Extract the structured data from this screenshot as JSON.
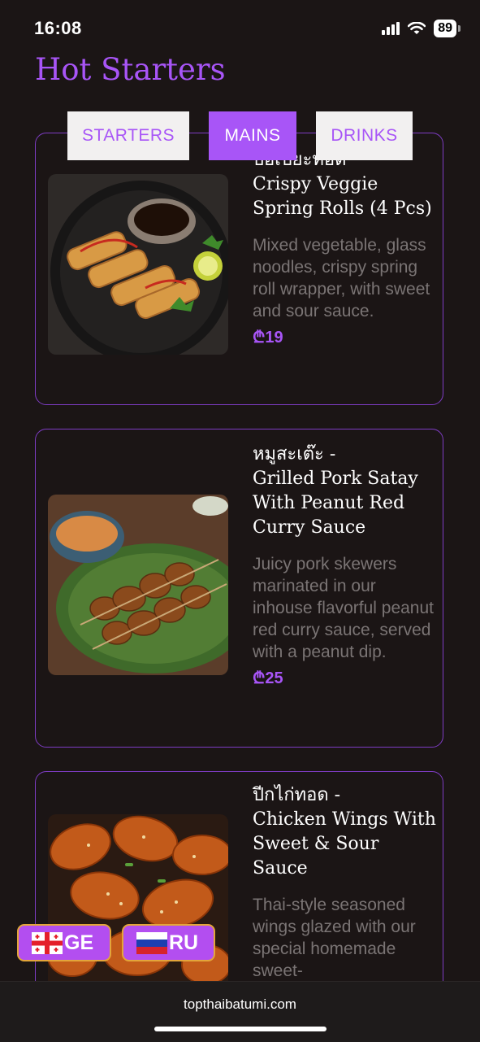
{
  "status_bar": {
    "time": "16:08",
    "battery": "89"
  },
  "page": {
    "title": "Hot Starters"
  },
  "tabs": [
    {
      "label": "STARTERS"
    },
    {
      "label": "MAINS"
    },
    {
      "label": "DRINKS"
    }
  ],
  "dishes": [
    {
      "title_thai": "ปอเปี๊ยะทอด",
      "title": "Crispy Veggie Spring Rolls (4 Pcs)",
      "description": "Mixed vegetable, glass noodles, crispy spring roll wrapper, with sweet and sour sauce.",
      "price": "₾19"
    },
    {
      "title_thai": "หมูสะเต๊ะ -",
      "title": "Grilled Pork Satay With Peanut Red Curry Sauce",
      "description": "Juicy pork skewers marinated in our inhouse flavorful peanut red curry sauce, served with a peanut dip.",
      "price": "₾25"
    },
    {
      "title_thai": "ปีกไก่ทอด -",
      "title": "Chicken Wings With Sweet & Sour Sauce",
      "description": "Thai-style seasoned wings glazed with our special homemade sweet-",
      "price": ""
    }
  ],
  "language_buttons": [
    {
      "label": "GE",
      "flag": "georgia-flag-icon"
    },
    {
      "label": "RU",
      "flag": "russia-flag-icon"
    }
  ],
  "browser": {
    "url": "topthaibatumi.com"
  },
  "colors": {
    "accent": "#a855f7",
    "background": "#1b1515",
    "card_border": "#7e3cc4",
    "muted_text": "#7a7474"
  }
}
